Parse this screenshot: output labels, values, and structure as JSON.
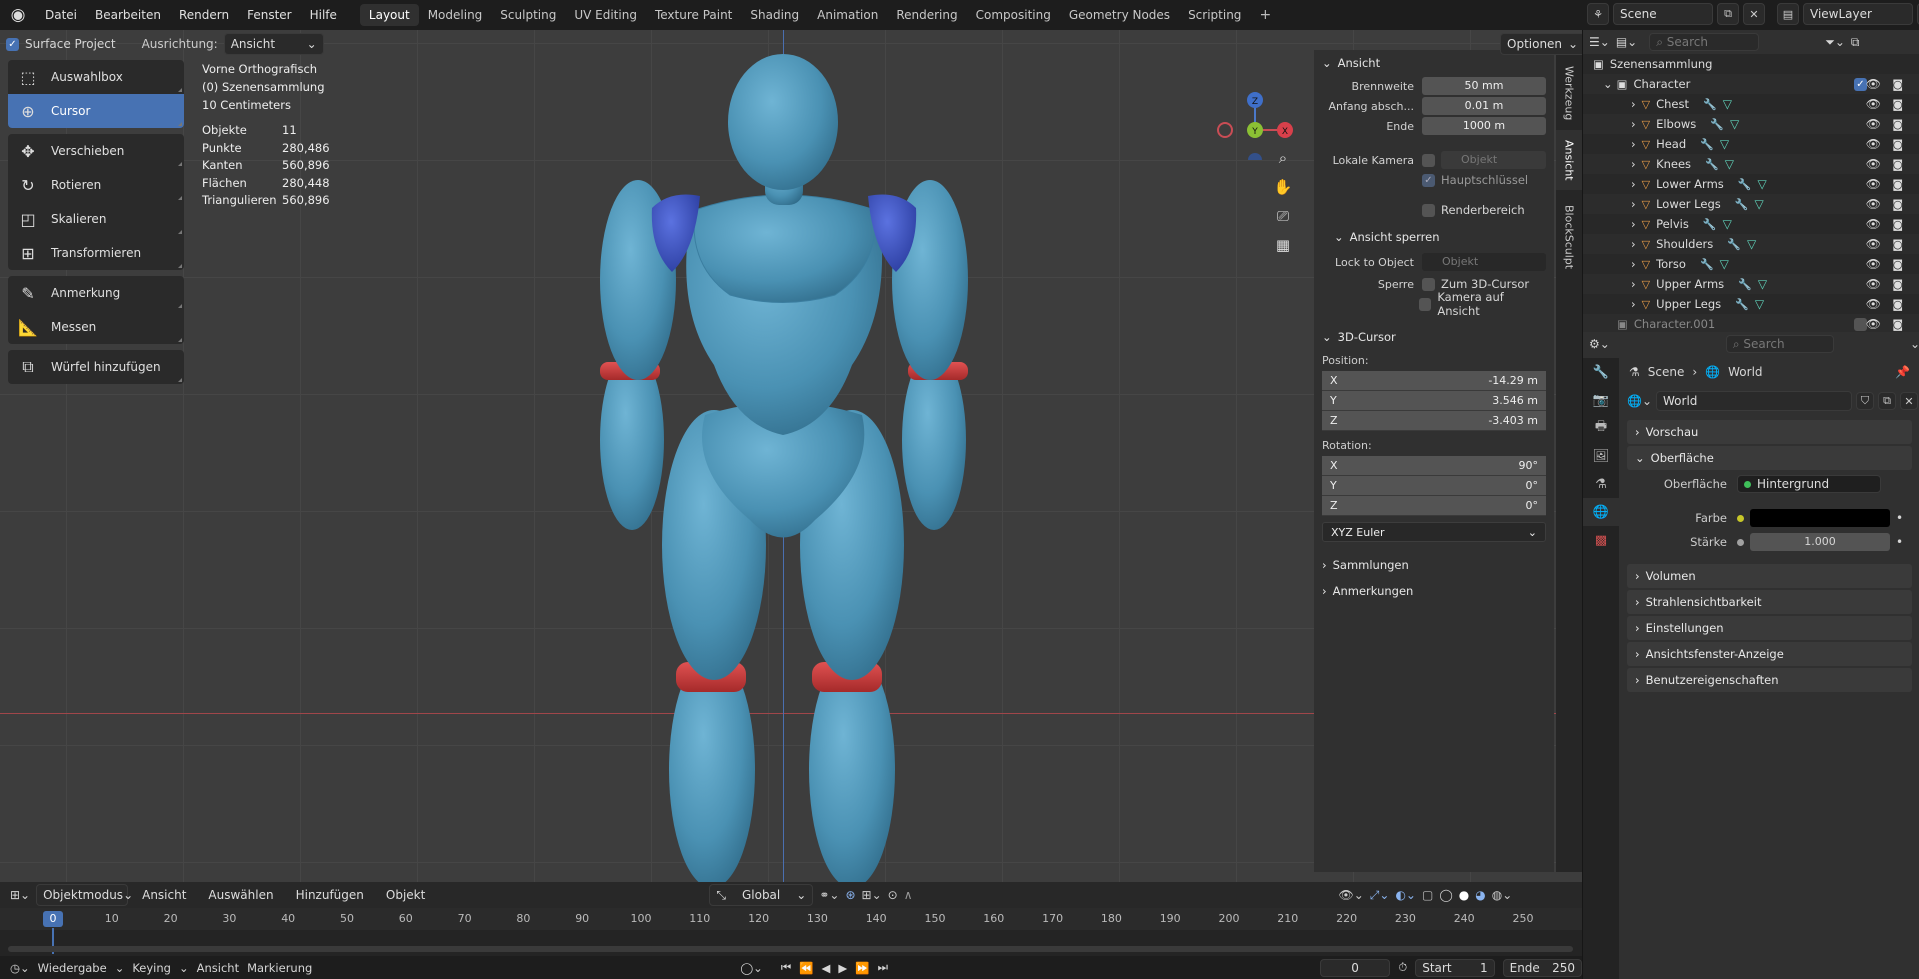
{
  "menu": [
    "Datei",
    "Bearbeiten",
    "Rendern",
    "Fenster",
    "Hilfe"
  ],
  "workspaces": [
    "Layout",
    "Modeling",
    "Sculpting",
    "UV Editing",
    "Texture Paint",
    "Shading",
    "Animation",
    "Rendering",
    "Compositing",
    "Geometry Nodes",
    "Scripting"
  ],
  "active_workspace": "Layout",
  "scene_name": "Scene",
  "view_layer": "ViewLayer",
  "viewport_header": {
    "surface_project": "Surface Project",
    "alignment_label": "Ausrichtung:",
    "alignment_value": "Ansicht",
    "options": "Optionen"
  },
  "tools": [
    {
      "label": "Auswahlbox",
      "icon": "select-box-icon",
      "active": false
    },
    {
      "label": "Cursor",
      "icon": "cursor-icon",
      "active": true
    },
    {
      "label": "Verschieben",
      "icon": "move-icon",
      "active": false
    },
    {
      "label": "Rotieren",
      "icon": "rotate-icon",
      "active": false
    },
    {
      "label": "Skalieren",
      "icon": "scale-icon",
      "active": false
    },
    {
      "label": "Transformieren",
      "icon": "transform-icon",
      "active": false
    },
    {
      "label": "Anmerkung",
      "icon": "annotate-icon",
      "active": false
    },
    {
      "label": "Messen",
      "icon": "measure-icon",
      "active": false
    },
    {
      "label": "Würfel hinzufügen",
      "icon": "add-cube-icon",
      "active": false
    }
  ],
  "viewport_info": {
    "view": "Vorne Orthografisch",
    "collection": "(0) Szenensammlung",
    "scale": "10 Centimeters"
  },
  "stats": [
    {
      "k": "Objekte",
      "v": "11"
    },
    {
      "k": "Punkte",
      "v": "280,486"
    },
    {
      "k": "Kanten",
      "v": "560,896"
    },
    {
      "k": "Flächen",
      "v": "280,448"
    },
    {
      "k": "Triangulieren",
      "v": "560,896"
    }
  ],
  "gizmo": {
    "z": "Z",
    "y": "Y",
    "x": "X"
  },
  "npanel": {
    "tabs": [
      "Werkzeug",
      "Ansicht",
      "BlockSculpt"
    ],
    "ansicht_title": "Ansicht",
    "brennweite_label": "Brennweite",
    "brennweite": "50 mm",
    "anfang_label": "Anfang absch...",
    "anfang": "0.01 m",
    "ende_label": "Ende",
    "ende": "1000 m",
    "lokale_kamera": "Lokale Kamera",
    "objekt_placeholder": "Objekt",
    "hauptschluessel": "Hauptschlüssel",
    "renderbereich": "Renderbereich",
    "ansicht_sperren": "Ansicht sperren",
    "lock_to_object": "Lock to Object",
    "sperre": "Sperre",
    "zum_3d_cursor": "Zum 3D-Cursor",
    "kamera_auf_ansicht": "Kamera auf Ansicht",
    "cursor_title": "3D-Cursor",
    "position_label": "Position:",
    "position": [
      {
        "axis": "X",
        "v": "-14.29 m"
      },
      {
        "axis": "Y",
        "v": "3.546 m"
      },
      {
        "axis": "Z",
        "v": "-3.403 m"
      }
    ],
    "rotation_label": "Rotation:",
    "rotation": [
      {
        "axis": "X",
        "v": "90°"
      },
      {
        "axis": "Y",
        "v": "0°"
      },
      {
        "axis": "Z",
        "v": "0°"
      }
    ],
    "rotation_mode": "XYZ Euler",
    "sammlungen": "Sammlungen",
    "anmerkungen": "Anmerkungen"
  },
  "viewport_footer": {
    "mode": "Objektmodus",
    "menus": [
      "Ansicht",
      "Auswählen",
      "Hinzufügen",
      "Objekt"
    ],
    "transform_orientation": "Global"
  },
  "timeline": {
    "current_frame": "0",
    "ticks": [
      "10",
      "20",
      "30",
      "40",
      "50",
      "60",
      "70",
      "80",
      "90",
      "100",
      "110",
      "120",
      "130",
      "140",
      "150",
      "160",
      "170",
      "180",
      "190",
      "200",
      "210",
      "220",
      "230",
      "240",
      "250"
    ],
    "start_label": "Start",
    "start": "1",
    "end_label": "Ende",
    "end": "250",
    "frame_field": "0"
  },
  "statusbar": {
    "playback": "Wiedergabe",
    "keying": "Keying",
    "view": "Ansicht",
    "markers": "Markierung"
  },
  "outliner": {
    "search_placeholder": "Search",
    "root": "Szenensammlung",
    "collection": "Character",
    "items": [
      "Chest",
      "Elbows",
      "Head",
      "Knees",
      "Lower Arms",
      "Lower Legs",
      "Pelvis",
      "Shoulders",
      "Torso",
      "Upper Arms",
      "Upper Legs"
    ],
    "other": "Character.001"
  },
  "properties": {
    "search_placeholder": "Search",
    "breadcrumb_scene": "Scene",
    "breadcrumb_world": "World",
    "world_name": "World",
    "sections_top": [
      "Vorschau"
    ],
    "oberflaeche": "Oberfläche",
    "surface_label": "Oberfläche",
    "surface_value": "Hintergrund",
    "farbe_label": "Farbe",
    "staerke_label": "Stärke",
    "staerke_value": "1.000",
    "sections_bottom": [
      "Volumen",
      "Strahlensichtbarkeit",
      "Einstellungen",
      "Ansichtsfenster-Anzeige",
      "Benutzereigenschaften"
    ]
  },
  "colors": {
    "accent": "#4772b3",
    "character": "#4f93b5",
    "shoulder": "#3a4fbf",
    "joint": "#c93b3b",
    "world_color": "#000000"
  }
}
